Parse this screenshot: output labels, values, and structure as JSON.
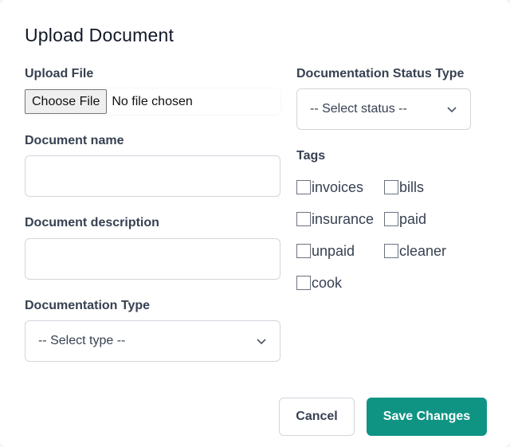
{
  "modal": {
    "title": "Upload Document"
  },
  "form": {
    "upload_file": {
      "label": "Upload File",
      "button_label": "Choose File",
      "status": "No file chosen"
    },
    "document_name": {
      "label": "Document name",
      "value": ""
    },
    "document_description": {
      "label": "Document description",
      "value": ""
    },
    "documentation_type": {
      "label": "Documentation Type",
      "selected": "-- Select type --"
    },
    "documentation_status_type": {
      "label": "Documentation Status Type",
      "selected": "-- Select status --"
    },
    "tags": {
      "label": "Tags",
      "items": [
        {
          "label": "invoices",
          "checked": false
        },
        {
          "label": "bills",
          "checked": false
        },
        {
          "label": "insurance",
          "checked": false
        },
        {
          "label": "paid",
          "checked": false
        },
        {
          "label": "unpaid",
          "checked": false
        },
        {
          "label": "cleaner",
          "checked": false
        },
        {
          "label": "cook",
          "checked": false
        }
      ]
    }
  },
  "footer": {
    "cancel_label": "Cancel",
    "save_label": "Save Changes"
  },
  "colors": {
    "primary": "#0f9484",
    "text": "#374151",
    "border": "#d1d5db"
  }
}
